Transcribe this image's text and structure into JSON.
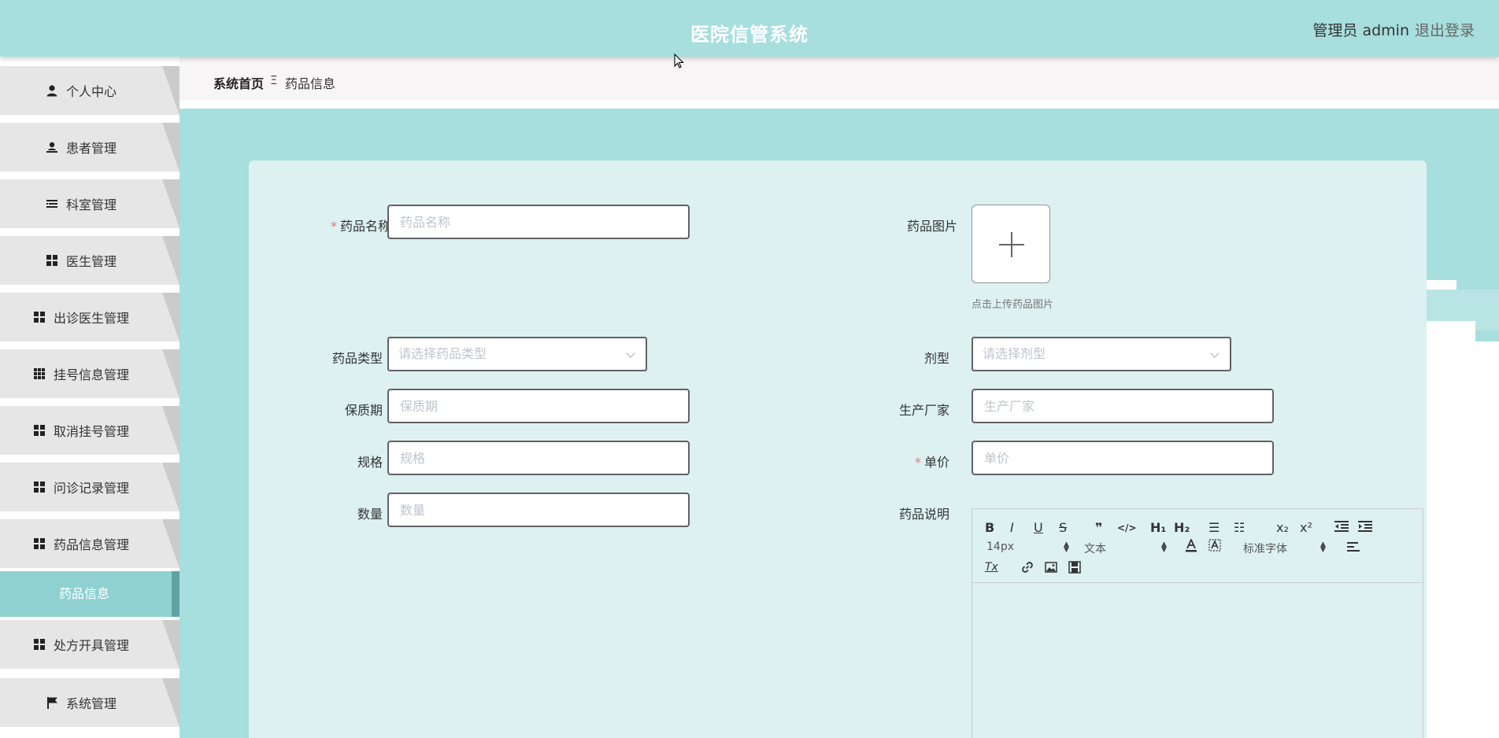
{
  "header": {
    "title": "医院信管系统",
    "user": "管理员 admin",
    "logout": "退出登录"
  },
  "sidebar": {
    "items": [
      {
        "label": "个人中心",
        "icon": "user-icon"
      },
      {
        "label": "患者管理",
        "icon": "person-badge-icon"
      },
      {
        "label": "科室管理",
        "icon": "list-icon"
      },
      {
        "label": "医生管理",
        "icon": "grid-icon"
      },
      {
        "label": "出诊医生管理",
        "icon": "grid-icon"
      },
      {
        "label": "挂号信息管理",
        "icon": "grid-nine-icon"
      },
      {
        "label": "取消挂号管理",
        "icon": "grid-icon"
      },
      {
        "label": "问诊记录管理",
        "icon": "grid-icon"
      },
      {
        "label": "药品信息管理",
        "icon": "grid-icon"
      },
      {
        "label": "处方开具管理",
        "icon": "grid-icon"
      },
      {
        "label": "系统管理",
        "icon": "flag-icon"
      }
    ],
    "active_sub": "药品信息"
  },
  "breadcrumb": {
    "home": "系统首页",
    "separator": "Ξ",
    "current": "药品信息"
  },
  "form": {
    "name": {
      "label": "药品名称",
      "placeholder": "药品名称",
      "required": true
    },
    "image": {
      "label": "药品图片",
      "hint": "点击上传药品图片"
    },
    "type": {
      "label": "药品类型",
      "placeholder": "请选择药品类型"
    },
    "dosage": {
      "label": "剂型",
      "placeholder": "请选择剂型"
    },
    "shelf_life": {
      "label": "保质期",
      "placeholder": "保质期"
    },
    "manufacturer": {
      "label": "生产厂家",
      "placeholder": "生产厂家"
    },
    "spec": {
      "label": "规格",
      "placeholder": "规格"
    },
    "price": {
      "label": "单价",
      "placeholder": "单价",
      "required": true
    },
    "quantity": {
      "label": "数量",
      "placeholder": "数量"
    },
    "description": {
      "label": "药品说明"
    }
  },
  "editor": {
    "bold": "B",
    "italic": "I",
    "underline": "U",
    "strike": "S",
    "quote": "❞",
    "code": "</>",
    "h1": "H₁",
    "h2": "H₂",
    "ordered_list": "☰",
    "bullet_list": "☷",
    "sub": "x₂",
    "sup": "x²",
    "size": "14px",
    "header_select": "文本",
    "font_select": "标准字体",
    "clean": "Tx"
  },
  "colors": {
    "header_bg": "#a7dede",
    "main_bg": "#a7dede",
    "card_bg": "#ddf1f1",
    "active_menu": "#8fd1d1",
    "required": "#f56c6c"
  }
}
